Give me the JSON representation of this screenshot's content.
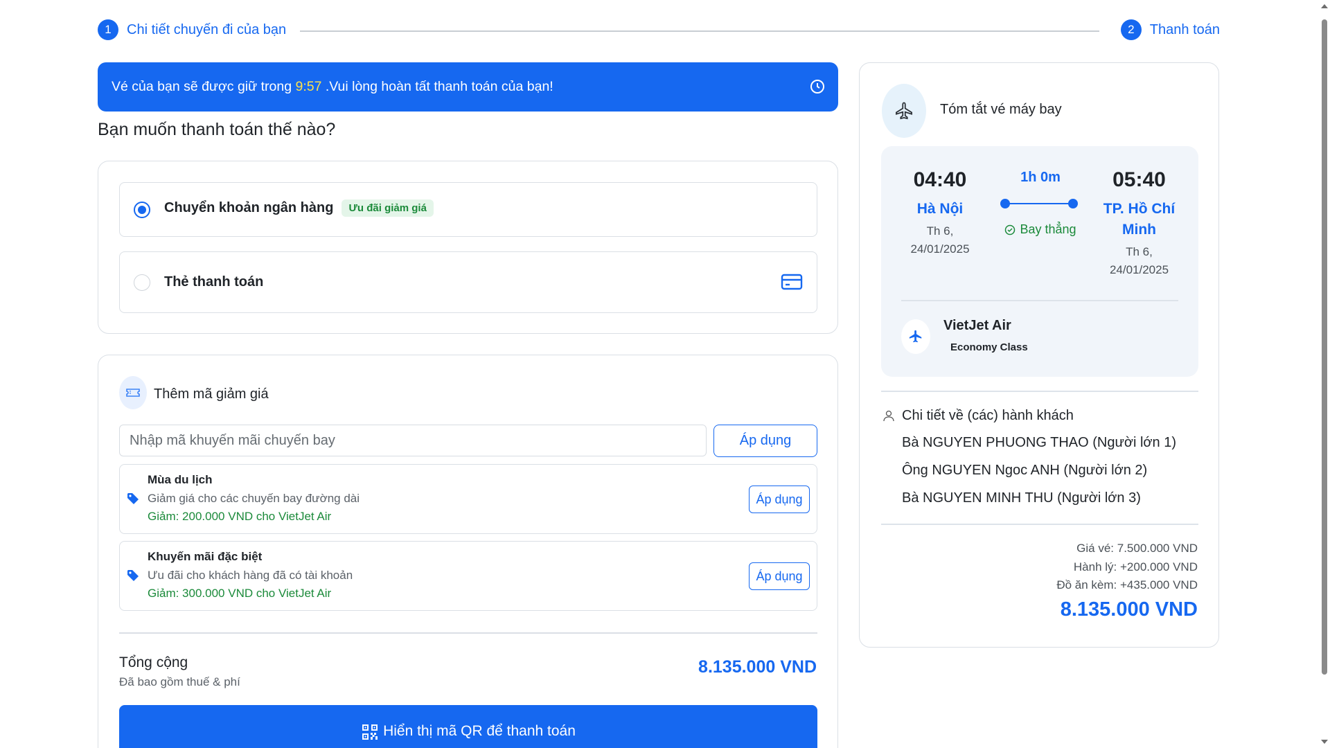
{
  "stepper": {
    "step1": {
      "number": "1",
      "label": "Chi tiết chuyến đi của bạn"
    },
    "step2": {
      "number": "2",
      "label": "Thanh toán"
    }
  },
  "banner": {
    "prefix": "Vé của bạn sẽ được giữ trong ",
    "time": "9:57",
    "suffix": " .Vui lòng hoàn tất thanh toán của bạn!",
    "icon": "clock-icon"
  },
  "payment": {
    "question": "Bạn muốn thanh toán thế nào?",
    "methods": [
      {
        "label": "Chuyển khoản ngân hàng",
        "badge": "Ưu đãi giảm giá",
        "selected": true
      },
      {
        "label": "Thẻ thanh toán",
        "selected": false,
        "icon": "credit-card-icon"
      }
    ]
  },
  "voucher": {
    "title": "Thêm mã giảm giá",
    "icon": "ticket-icon",
    "input_placeholder": "Nhập mã khuyến mãi chuyến bay",
    "apply_label": "Áp dụng",
    "promos": [
      {
        "name": "Mùa du lịch",
        "desc": "Giảm giá cho các chuyến bay đường dài",
        "value": "Giảm: 200.000 VND cho VietJet Air",
        "apply_label": "Áp dụng"
      },
      {
        "name": "Khuyến mãi đặc biệt",
        "desc": "Ưu đãi cho khách hàng đã có tài khoản",
        "value": "Giảm: 300.000 VND cho VietJet Air",
        "apply_label": "Áp dụng"
      }
    ]
  },
  "total": {
    "label": "Tổng cộng",
    "sub": "Đã bao gồm thuế & phí",
    "amount": "8.135.000 VND",
    "qr_button": "Hiển thị mã QR để thanh toán"
  },
  "summary": {
    "title": "Tóm tắt vé máy bay",
    "flight": {
      "departure": {
        "time": "04:40",
        "city": "Hà Nội",
        "day": "Th 6,",
        "date": "24/01/2025"
      },
      "arrival": {
        "time": "05:40",
        "city": "TP. Hồ Chí Minh",
        "day": "Th 6,",
        "date": "24/01/2025"
      },
      "duration": "1h 0m",
      "type": "Bay thẳng"
    },
    "airline": {
      "name": "VietJet Air",
      "class": "Economy Class"
    },
    "passengers_title": "Chi tiết về (các) hành khách",
    "passengers": [
      "Bà NGUYEN PHUONG THAO (Người lớn 1)",
      "Ông NGUYEN Ngoc ANH (Người lớn 2)",
      "Bà NGUYEN MINH THU (Người lớn 3)"
    ],
    "prices": {
      "ticket": "Giá vé: 7.500.000 VND",
      "baggage": "Hành lý: +200.000 VND",
      "meal": "Đồ ăn kèm: +435.000 VND"
    },
    "grand_total": "8.135.000 VND"
  },
  "colors": {
    "primary": "#1668f0",
    "success": "#1b8a3a",
    "timer": "#ffe24a"
  }
}
